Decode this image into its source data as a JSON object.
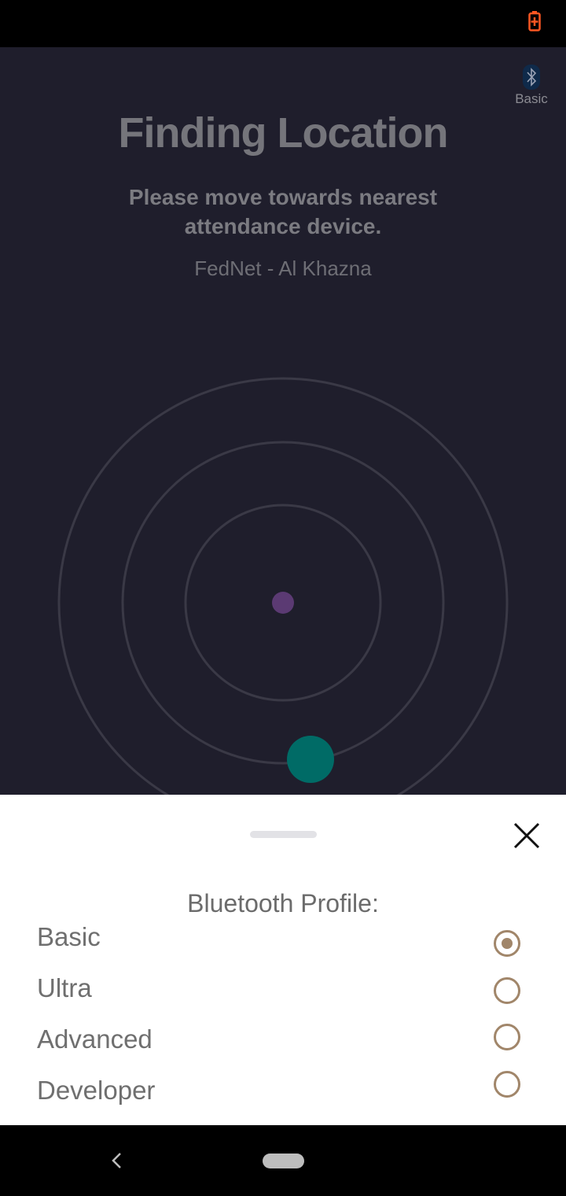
{
  "status_bar": {
    "battery_icon": "battery-charging-icon",
    "battery_color": "#ff5722"
  },
  "header": {
    "profile_icon": "bluetooth-icon",
    "profile_label": "Basic",
    "title": "Finding Location",
    "subtitle": "Please move towards nearest attendance device.",
    "org_name": "FedNet - Al Khazna"
  },
  "colors": {
    "app_background": "#1f1e2c",
    "ring": "#3a3946",
    "center_dot": "#5b3a73",
    "device_dot": "#006b66",
    "accent": "#a1866a"
  },
  "bottom_sheet": {
    "title": "Bluetooth Profile:",
    "close_icon": "close-icon",
    "options": [
      {
        "label": "Basic",
        "selected": true
      },
      {
        "label": "Ultra",
        "selected": false
      },
      {
        "label": "Advanced",
        "selected": false
      },
      {
        "label": "Developer",
        "selected": false
      }
    ]
  },
  "nav_bar": {
    "back_icon": "back-icon",
    "home_icon": "home-pill-icon"
  }
}
